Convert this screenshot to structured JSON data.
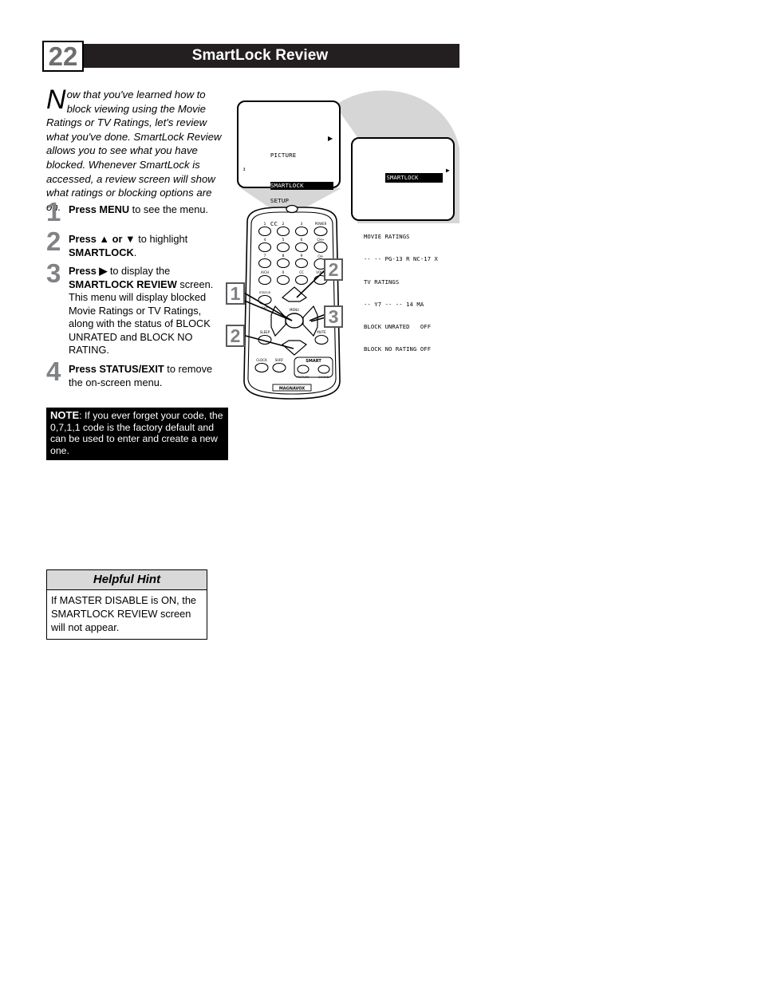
{
  "header": {
    "page_number": "22",
    "title": "SmartLock Review"
  },
  "intro": {
    "dropcap": "N",
    "text": "ow that you've learned how to block viewing using the Movie Ratings or TV Ratings, let's review what you've done. SmartLock Review allows you to see what you have blocked. Whenever SmartLock is accessed, a review screen will show what ratings or blocking options are on."
  },
  "steps": [
    {
      "num": "1",
      "bold1": "Press MENU",
      "rest1": " to see the menu.",
      "bold2": "",
      "rest2": ""
    },
    {
      "num": "2",
      "bold1": "Press ▲ or ▼",
      "rest1": " to highlight ",
      "bold2": "SMARTLOCK",
      "rest2": "."
    },
    {
      "num": "3",
      "bold1": "Press ▶",
      "rest1": " to display the ",
      "bold2": "SMARTLOCK REVIEW",
      "rest2": " screen. This menu will display blocked Movie Ratings or TV Ratings, along with the status of BLOCK UNRATED and BLOCK NO RATING."
    },
    {
      "num": "4",
      "bold1": "Press STATUS/EXIT",
      "rest1": " to remove the on-screen menu.",
      "bold2": "",
      "rest2": ""
    }
  ],
  "note": {
    "label": "NOTE",
    "text": ": If you ever forget your code, the 0,7,1,1 code is the factory default and can be used to enter and create a new one."
  },
  "hint": {
    "heading": "Helpful Hint",
    "body": "If MASTER DISABLE is ON, the SMARTLOCK REVIEW screen will not appear."
  },
  "tv_menu_1": {
    "items": [
      "PICTURE",
      "SMARTLOCK",
      "SETUP",
      "CC"
    ],
    "selected": "SMARTLOCK",
    "caret": "↕",
    "right_arrow": "▶"
  },
  "tv_menu_2": {
    "title": "SMARTLOCK",
    "right_arrow": "▶",
    "lines": [
      "MOVIE RATINGS",
      "-- -- PG-13 R NC-17 X",
      "TV RATINGS",
      "-- Y7 -- -- 14 MA",
      "BLOCK UNRATED   OFF",
      "BLOCK NO RATING OFF"
    ]
  },
  "callouts": {
    "one": "1",
    "two_a": "2",
    "two_b": "2",
    "three": "3"
  },
  "remote": {
    "brand": "MAGNAVOX",
    "keypad": [
      "1",
      "2",
      "3",
      "POWER",
      "4",
      "5",
      "6",
      "CH+",
      "7",
      "8",
      "9",
      "CH-",
      "A/CH",
      "0",
      "CC",
      "VOL+"
    ],
    "status_label": "STATUS\nEXIT",
    "menu_label": "MENU",
    "sleep_label": "SLEEP",
    "mute_label": "MUTE",
    "clock_label": "CLOCK",
    "surf_label": "SURF",
    "smart_label": "SMART",
    "smart_picture_label": "PICTURE",
    "smart_sound_label": "SOUND"
  },
  "colors": {
    "header_bg": "#231f20",
    "page_num_fg": "#6d6e70",
    "step_num_fg": "#808285",
    "hint_head_bg": "#d9d9d9",
    "callout_border": "#58595b",
    "beam_gray": "#d6d6d6"
  }
}
